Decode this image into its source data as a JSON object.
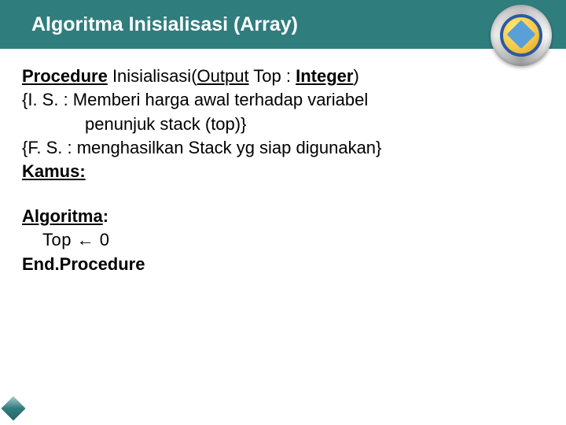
{
  "header": {
    "title": "Algoritma Inisialisasi (Array)"
  },
  "content": {
    "proc_word": "Procedure",
    "proc_name": " Inisialisasi(",
    "output_word": "Output",
    "proc_mid": "  Top : ",
    "integer_word": "Integer",
    "proc_close": ")",
    "is_line": "{I. S. : Memberi harga awal terhadap variabel",
    "is_line2": "penunjuk stack (top)}",
    "fs_line": "{F. S. : menghasilkan Stack yg siap digunakan}",
    "kamus": "Kamus:",
    "algoritma": "Algoritma",
    "algoritma_colon": ":",
    "top_assign": "Top  ←  0",
    "end_proc": "End.Procedure"
  },
  "icons": {
    "logo": "university-logo",
    "diamond": "decorative-diamond"
  }
}
